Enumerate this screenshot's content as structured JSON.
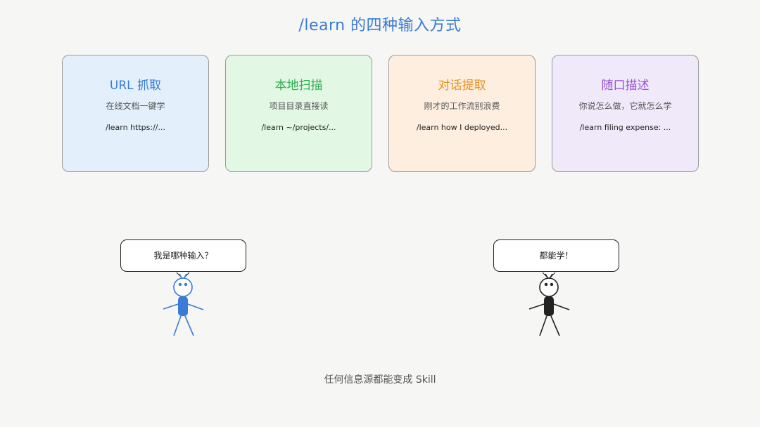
{
  "title": "/learn 的四种输入方式",
  "cards": [
    {
      "title": "URL 抓取",
      "subtitle": "在线文档一键学",
      "command": "/learn https://...",
      "color": "#3a7bd5"
    },
    {
      "title": "本地扫描",
      "subtitle": "项目目录直接读",
      "command": "/learn ~/projects/...",
      "color": "#2eae4f"
    },
    {
      "title": "对话提取",
      "subtitle": "刚才的工作流别浪费",
      "command": "/learn how I deployed...",
      "color": "#e8901f"
    },
    {
      "title": "随口描述",
      "subtitle": "你说怎么做，它就怎么学",
      "command": "/learn filing expense: ...",
      "color": "#9a4fd6"
    }
  ],
  "characters": [
    {
      "speech": "我是哪种输入？",
      "color": "#3a7bd5"
    },
    {
      "speech": "都能学！",
      "color": "#222222"
    }
  ],
  "caption": "任何信息源都能变成 Skill"
}
